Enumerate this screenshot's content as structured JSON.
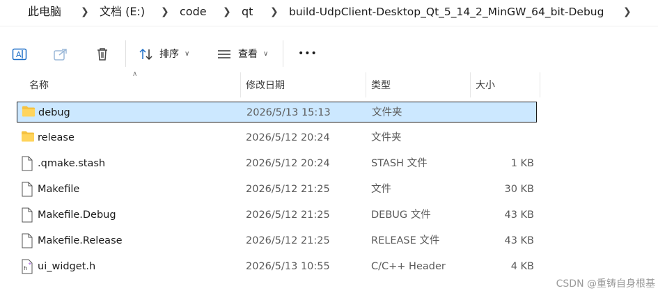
{
  "breadcrumb": {
    "items": [
      "此电脑",
      "文档 (E:)",
      "code",
      "qt",
      "build-UdpClient-Desktop_Qt_5_14_2_MinGW_64_bit-Debug"
    ]
  },
  "toolbar": {
    "sort_label": "排序",
    "view_label": "查看",
    "more_label": "•••"
  },
  "columns": {
    "name": "名称",
    "modified": "修改日期",
    "type": "类型",
    "size": "大小"
  },
  "files": [
    {
      "name": "debug",
      "modified": "2026/5/13 15:13",
      "type": "文件夹",
      "size": "",
      "icon": "folder-icon",
      "selected": true
    },
    {
      "name": "release",
      "modified": "2026/5/12 20:24",
      "type": "文件夹",
      "size": "",
      "icon": "folder-icon",
      "selected": false
    },
    {
      "name": ".qmake.stash",
      "modified": "2026/5/12 20:24",
      "type": "STASH 文件",
      "size": "1 KB",
      "icon": "file-icon",
      "selected": false
    },
    {
      "name": "Makefile",
      "modified": "2026/5/12 21:25",
      "type": "文件",
      "size": "30 KB",
      "icon": "file-icon",
      "selected": false
    },
    {
      "name": "Makefile.Debug",
      "modified": "2026/5/12 21:25",
      "type": "DEBUG 文件",
      "size": "43 KB",
      "icon": "file-icon",
      "selected": false
    },
    {
      "name": "Makefile.Release",
      "modified": "2026/5/12 21:25",
      "type": "RELEASE 文件",
      "size": "43 KB",
      "icon": "file-icon",
      "selected": false
    },
    {
      "name": "ui_widget.h",
      "modified": "2026/5/13 10:55",
      "type": "C/C++ Header",
      "size": "4 KB",
      "icon": "header-file-icon",
      "selected": false
    }
  ],
  "watermark": "CSDN @重铸自身根基",
  "colors": {
    "selection_bg": "#cce8ff",
    "folder": "#f5c242",
    "accent": "#1e6fc7"
  }
}
